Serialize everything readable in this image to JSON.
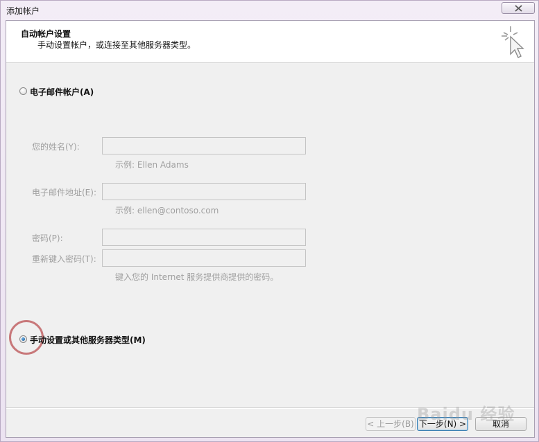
{
  "window": {
    "title": "添加帐户"
  },
  "header": {
    "title": "自动帐户设置",
    "subtitle": "手动设置帐户，或连接至其他服务器类型。",
    "icon": "wizard-sparkle-cursor-icon"
  },
  "options": {
    "email_account_label": "电子邮件帐户(A)",
    "email_account_checked": false,
    "manual_setup_label": "手动设置或其他服务器类型(M)",
    "manual_setup_checked": true
  },
  "form": {
    "name_label": "您的姓名(Y):",
    "name_value": "",
    "name_hint": "示例: Ellen Adams",
    "email_label": "电子邮件地址(E):",
    "email_value": "",
    "email_hint": "示例: ellen@contoso.com",
    "password_label": "密码(P):",
    "password_value": "",
    "retype_label": "重新键入密码(T):",
    "retype_value": "",
    "password_hint": "键入您的 Internet 服务提供商提供的密码。"
  },
  "buttons": {
    "back": "< 上一步(B)",
    "next": "下一步(N) >",
    "cancel": "取消"
  },
  "watermark": "Baidu 经验",
  "colors": {
    "highlight_ring": "#c8787a",
    "radio_selected": "#1c5f9e"
  }
}
